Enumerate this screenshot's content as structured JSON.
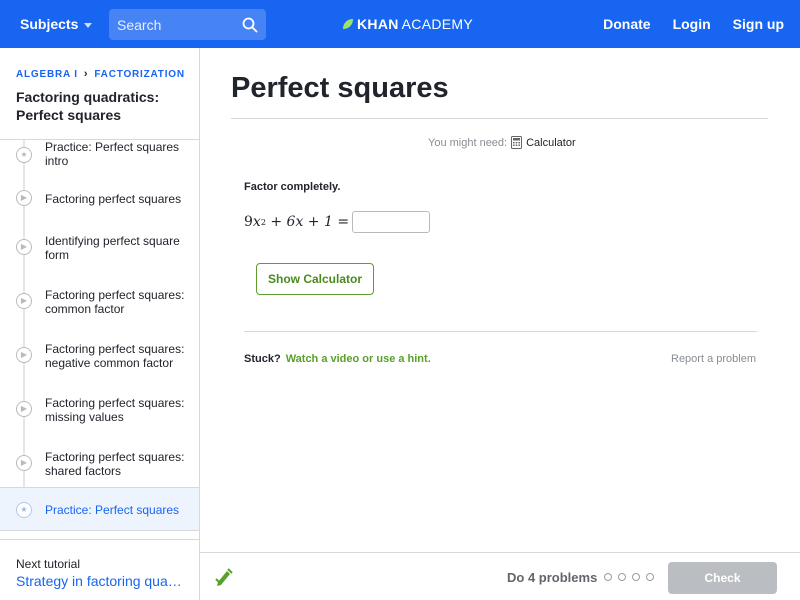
{
  "header": {
    "subjects_label": "Subjects",
    "search_placeholder": "Search",
    "logo_khan": "KHAN",
    "logo_academy": "ACADEMY",
    "donate": "Donate",
    "login": "Login",
    "signup": "Sign up",
    "brand_color": "#1865f2"
  },
  "sidebar": {
    "breadcrumb": [
      "ALGEBRA I",
      "FACTORIZATION"
    ],
    "tutorial_title": "Factoring quadratics: Perfect squares",
    "items": [
      {
        "label": "Practice: Perfect squares intro",
        "icon": "star-icon"
      },
      {
        "label": "Factoring perfect squares",
        "icon": "play-icon"
      },
      {
        "label": "Identifying perfect square form",
        "icon": "play-icon"
      },
      {
        "label": "Factoring perfect squares: common factor",
        "icon": "play-icon"
      },
      {
        "label": "Factoring perfect squares: negative common factor",
        "icon": "play-icon"
      },
      {
        "label": "Factoring perfect squares: missing values",
        "icon": "play-icon"
      },
      {
        "label": "Factoring perfect squares: shared factors",
        "icon": "play-icon"
      },
      {
        "label": "Practice: Perfect squares",
        "icon": "star-icon",
        "active": true
      }
    ],
    "next_label": "Next tutorial",
    "next_link": "Strategy in factoring quadratics"
  },
  "main": {
    "title": "Perfect squares",
    "might_need": "You might need:",
    "calculator": "Calculator",
    "prompt": "Factor completely.",
    "equation": {
      "coef": "9",
      "var1": "x",
      "exp": "2",
      "rest": " + 6x + 1 ="
    },
    "answer_value": "",
    "show_calculator": "Show Calculator",
    "stuck": "Stuck?",
    "stuck_link": "Watch a video or use a hint.",
    "report": "Report a problem"
  },
  "footer": {
    "do_problems": "Do 4 problems",
    "progress_dots": 4,
    "check": "Check"
  }
}
